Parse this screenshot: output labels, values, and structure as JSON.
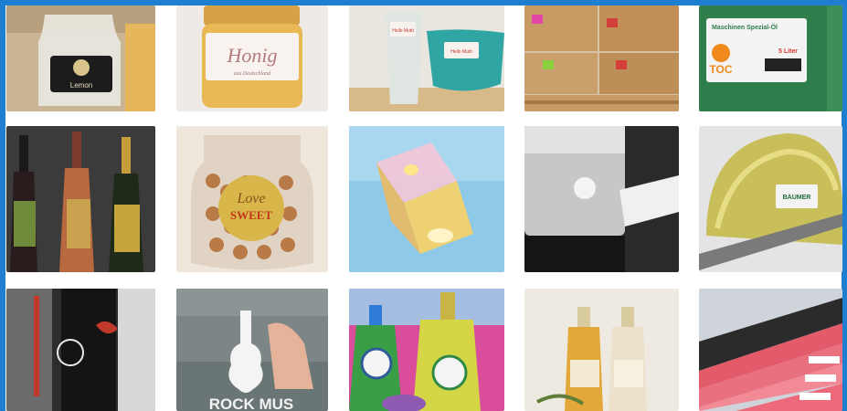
{
  "brand_color": "#1E7FD0",
  "tiles": {
    "lemon_label": "Lemon",
    "honey_label": "Honig",
    "honey_sub": "aus Deutschland",
    "cup_label": "Hello Mutti",
    "oil_title": "Maschinen Spezial-Öl",
    "oil_brand": "TOC",
    "oil_volume": "5 Liter",
    "love_top": "Love",
    "love_bottom": "SWEET",
    "helmet_brand": "BAUMER",
    "store_text": "ROCK MUS"
  }
}
